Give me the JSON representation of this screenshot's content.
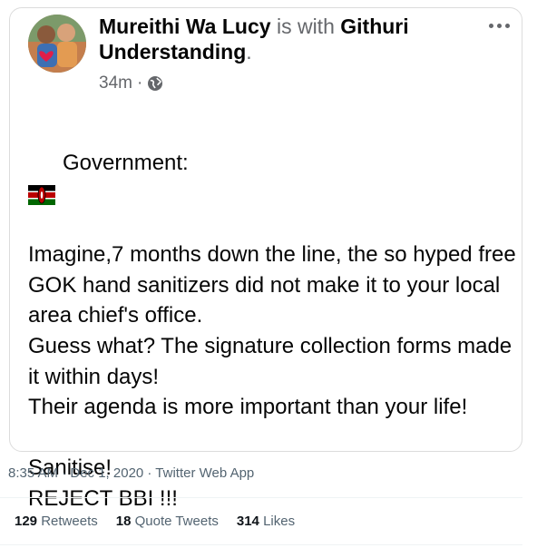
{
  "post": {
    "author_name": "Mureithi Wa Lucy",
    "with_text": "is with",
    "tagged_name": "Githuri Understanding",
    "time_ago": "34m",
    "privacy_icon": "globe-icon",
    "more_icon": "more-dots-icon",
    "flag_icon": "kenya-flag-icon",
    "heading": "Government:",
    "body": "Imagine,7 months down the line, the so hyped free GOK hand sanitizers did not make it to your local area chief's office.\nGuess what? The  signature collection forms made it within days!\nTheir agenda is more important than your life!\n\nSanitise!\nREJECT BBI !!!"
  },
  "tweet": {
    "timestamp": "8:35 AM · Dec 1, 2020 · Twitter Web App",
    "retweets_count": "129",
    "retweets_label": "Retweets",
    "quotes_count": "18",
    "quotes_label": "Quote Tweets",
    "likes_count": "314",
    "likes_label": "Likes"
  }
}
